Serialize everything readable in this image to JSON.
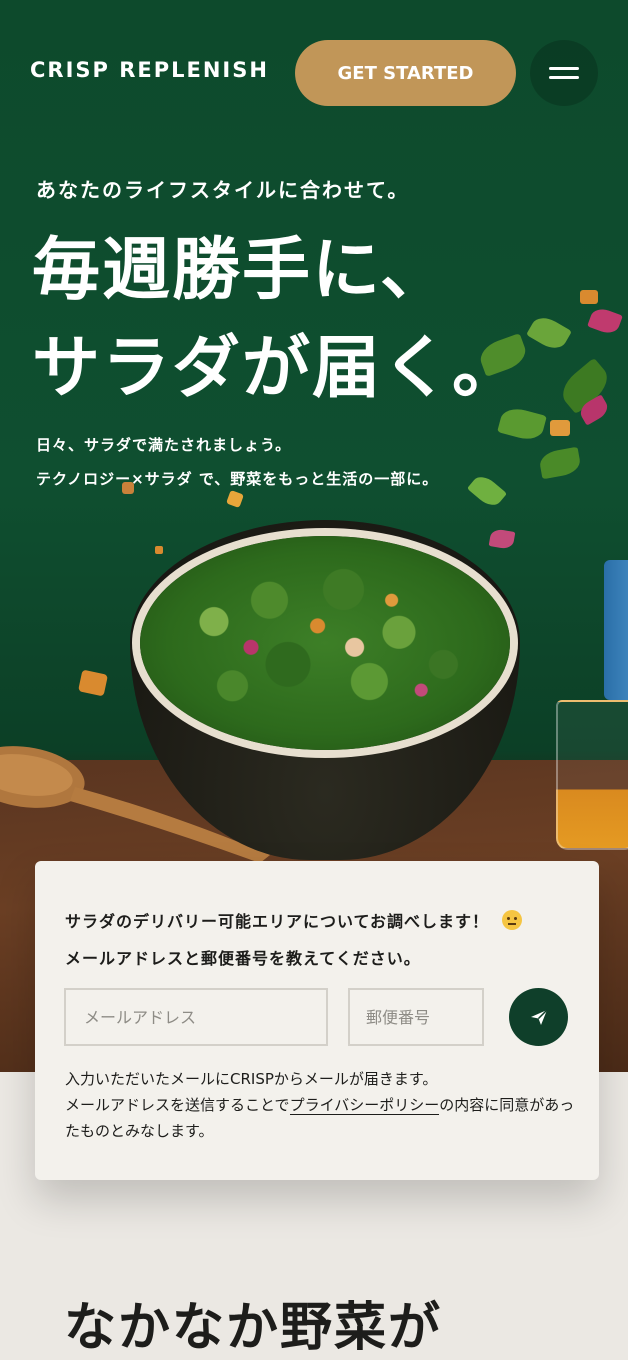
{
  "header": {
    "logo": "CRISP REPLENISH",
    "cta_label": "GET STARTED",
    "menu_icon": "hamburger-menu-icon"
  },
  "hero": {
    "tagline": "あなたのライフスタイルに合わせて。",
    "headline_line1": "毎週勝手に、",
    "headline_line2": "サラダが届く。",
    "sub_line1": "日々、サラダで満たされましょう。",
    "sub_line2": "テクノロジー×サラダ で、野菜をもっと生活の一部に。"
  },
  "delivery_form": {
    "lead_line1": "サラダのデリバリー可能エリアについてお調べします！",
    "lead_emoji": "thinking-face-icon",
    "lead_line2": "メールアドレスと郵便番号を教えてください。",
    "email_placeholder": "メールアドレス",
    "zip_placeholder": "郵便番号",
    "send_icon": "paper-plane-icon",
    "note_line1": "入力いただいたメールにCRISPからメールが届きます。",
    "note_line2_pre": "メールアドレスを送信することで",
    "privacy_link": "プライバシーポリシー",
    "note_line2_post": "の内容に同意があったものとみなします。"
  },
  "next_section": {
    "title": "なかなか野菜が"
  },
  "colors": {
    "hero_green": "#0d4a2c",
    "cta_gold": "#c19658",
    "send_button": "#0f3f2a",
    "card_bg": "#f3f1ec",
    "page_bg": "#ebe8e3"
  }
}
